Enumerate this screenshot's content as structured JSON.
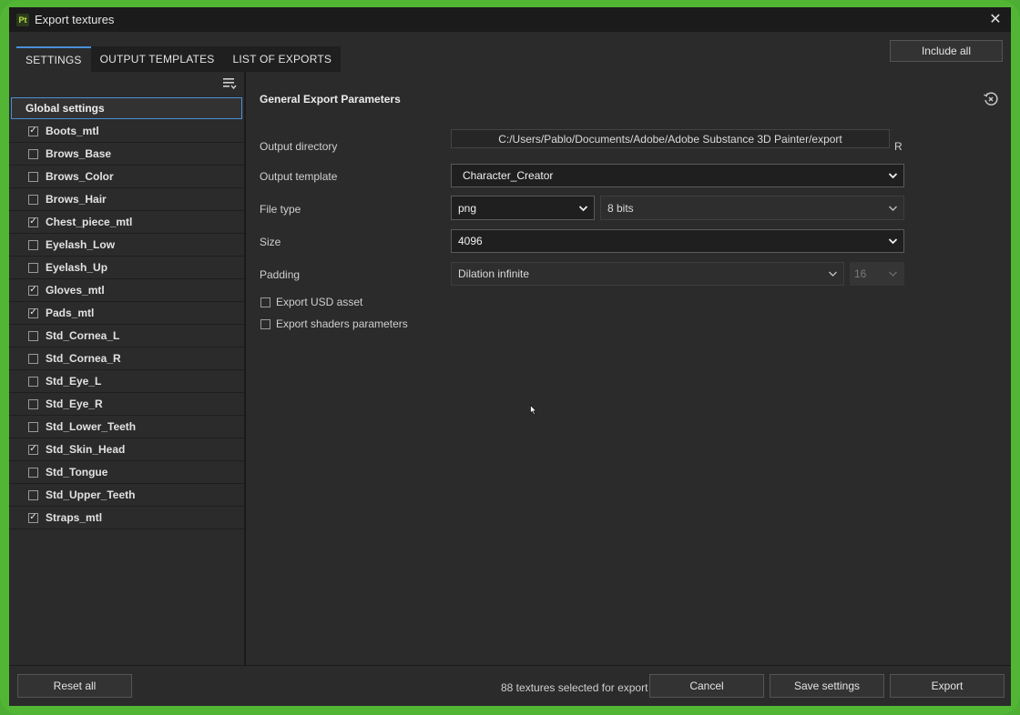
{
  "window": {
    "title": "Export textures",
    "app_icon_label": "Pt"
  },
  "tabs": [
    {
      "label": "SETTINGS",
      "active": true
    },
    {
      "label": "OUTPUT TEMPLATES",
      "active": false
    },
    {
      "label": "LIST OF EXPORTS",
      "active": false
    }
  ],
  "header": {
    "include_all_label": "Include all"
  },
  "sidebar": {
    "global_label": "Global settings",
    "materials": [
      {
        "label": "Boots_mtl",
        "checked": true
      },
      {
        "label": "Brows_Base",
        "checked": false
      },
      {
        "label": "Brows_Color",
        "checked": false
      },
      {
        "label": "Brows_Hair",
        "checked": false
      },
      {
        "label": "Chest_piece_mtl",
        "checked": true
      },
      {
        "label": "Eyelash_Low",
        "checked": false
      },
      {
        "label": "Eyelash_Up",
        "checked": false
      },
      {
        "label": "Gloves_mtl",
        "checked": true
      },
      {
        "label": "Pads_mtl",
        "checked": true
      },
      {
        "label": "Std_Cornea_L",
        "checked": false
      },
      {
        "label": "Std_Cornea_R",
        "checked": false
      },
      {
        "label": "Std_Eye_L",
        "checked": false
      },
      {
        "label": "Std_Eye_R",
        "checked": false
      },
      {
        "label": "Std_Lower_Teeth",
        "checked": false
      },
      {
        "label": "Std_Skin_Head",
        "checked": true
      },
      {
        "label": "Std_Tongue",
        "checked": false
      },
      {
        "label": "Std_Upper_Teeth",
        "checked": false
      },
      {
        "label": "Straps_mtl",
        "checked": true
      }
    ]
  },
  "params": {
    "section_title": "General Export Parameters",
    "output_directory": {
      "label": "Output directory",
      "value": "C:/Users/Pablo/Documents/Adobe/Adobe Substance 3D Painter/export",
      "suffix": "R"
    },
    "output_template": {
      "label": "Output template",
      "value": "Character_Creator"
    },
    "file_type": {
      "label": "File type",
      "format": "png",
      "bit_depth": "8 bits"
    },
    "size": {
      "label": "Size",
      "value": "4096"
    },
    "padding": {
      "label": "Padding",
      "mode": "Dilation infinite",
      "distance": "16"
    },
    "export_usd": {
      "label": "Export USD asset",
      "checked": false
    },
    "export_shaders": {
      "label": "Export shaders parameters",
      "checked": false
    }
  },
  "footer": {
    "reset_all_label": "Reset all",
    "status": "88 textures selected for export",
    "cancel_label": "Cancel",
    "save_settings_label": "Save settings",
    "export_label": "Export"
  },
  "colors": {
    "frame": "#52b634",
    "window_bg": "#2b2b2b",
    "accent": "#4a90d9"
  }
}
